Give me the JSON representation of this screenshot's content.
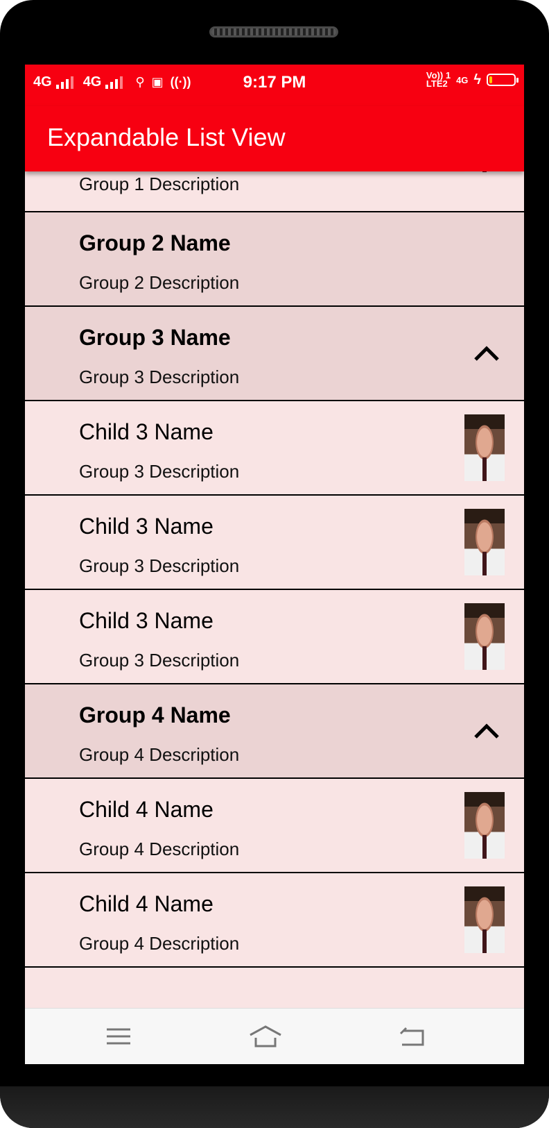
{
  "status_bar": {
    "sim1": "4G",
    "sim2": "4G",
    "time": "9:17 PM",
    "volte_top": "Vo)) 1",
    "volte_bottom": "LTE2",
    "net": "4G",
    "battery_level": 0.12
  },
  "app_bar": {
    "title": "Expandable List View"
  },
  "list": {
    "rows": [
      {
        "type": "child-partial",
        "title": "",
        "description": "Group 1 Description",
        "has_thumb": true
      },
      {
        "type": "group",
        "title": "Group 2 Name",
        "description": "Group 2 Description",
        "expanded": false
      },
      {
        "type": "group",
        "title": "Group 3 Name",
        "description": "Group 3 Description",
        "expanded": true
      },
      {
        "type": "child",
        "title": "Child 3 Name",
        "description": "Group 3 Description"
      },
      {
        "type": "child",
        "title": "Child 3 Name",
        "description": "Group 3 Description"
      },
      {
        "type": "child",
        "title": "Child 3 Name",
        "description": "Group 3 Description"
      },
      {
        "type": "group",
        "title": "Group 4 Name",
        "description": "Group 4 Description",
        "expanded": true
      },
      {
        "type": "child",
        "title": "Child 4 Name",
        "description": "Group 4 Description"
      },
      {
        "type": "child",
        "title": "Child 4 Name",
        "description": "Group 4 Description"
      }
    ]
  },
  "nav_bar": {
    "icons": [
      "menu-icon",
      "home-icon",
      "back-icon"
    ]
  },
  "colors": {
    "accent": "#f70011",
    "group_bg": "#ebd3d3",
    "child_bg": "#f9e4e4"
  }
}
